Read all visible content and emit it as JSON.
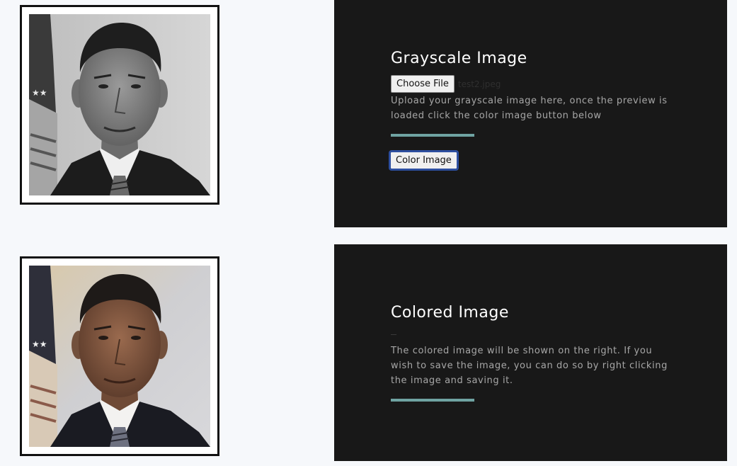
{
  "grayscale_section": {
    "title": "Grayscale Image",
    "choose_file_label": "Choose File",
    "file_name": "test2.jpeg",
    "description": "Upload your grayscale image here, once the preview is loaded click the color image button below",
    "color_button_label": "Color Image"
  },
  "colored_section": {
    "title": "Colored Image",
    "description": "The colored image will be shown on the right. If you wish to save the image, you can do so by right clicking the image and saving it."
  },
  "colors": {
    "panel_background": "#181818",
    "page_background": "#f6f8fb",
    "accent": "#6fa3a2",
    "focus_ring": "#2d4fa0"
  }
}
